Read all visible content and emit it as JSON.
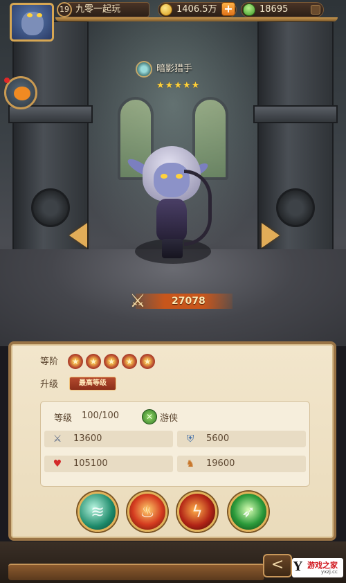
{
  "player": {
    "level": "19",
    "name": "九零一起玩",
    "gold": "1406.5万",
    "gems": "18695"
  },
  "hero": {
    "name": "暗影猎手",
    "stars": [
      "★",
      "★",
      "★",
      "★",
      "★"
    ],
    "power": "27078"
  },
  "panel": {
    "rank_label": "等阶",
    "rank_stars": [
      "★",
      "★",
      "★",
      "★",
      "★"
    ],
    "upgrade_label": "升级",
    "max_level_text": "最高等级",
    "level_label": "等级",
    "level_value": "100/100",
    "class_name": "游侠",
    "stats": {
      "attack": "13600",
      "defense": "5600",
      "hp": "105100",
      "speed": "19600"
    }
  },
  "watermark": {
    "logo": "Y",
    "main": "游戏之家",
    "sub": "yxzj.cc"
  },
  "colors": {
    "gold_accent": "#e2ad58",
    "panel_bg": "#f2e6cc",
    "power_bar": "#c8561b"
  },
  "icons": {
    "gold": "coin-icon",
    "gems": "gem-icon",
    "hero_type": "skull-icon",
    "power": "crossed-swords-icon",
    "class": "ranger-icon",
    "attack": "sword-icon",
    "defense": "shield-icon",
    "hp": "heart-icon",
    "speed": "boot-icon"
  }
}
